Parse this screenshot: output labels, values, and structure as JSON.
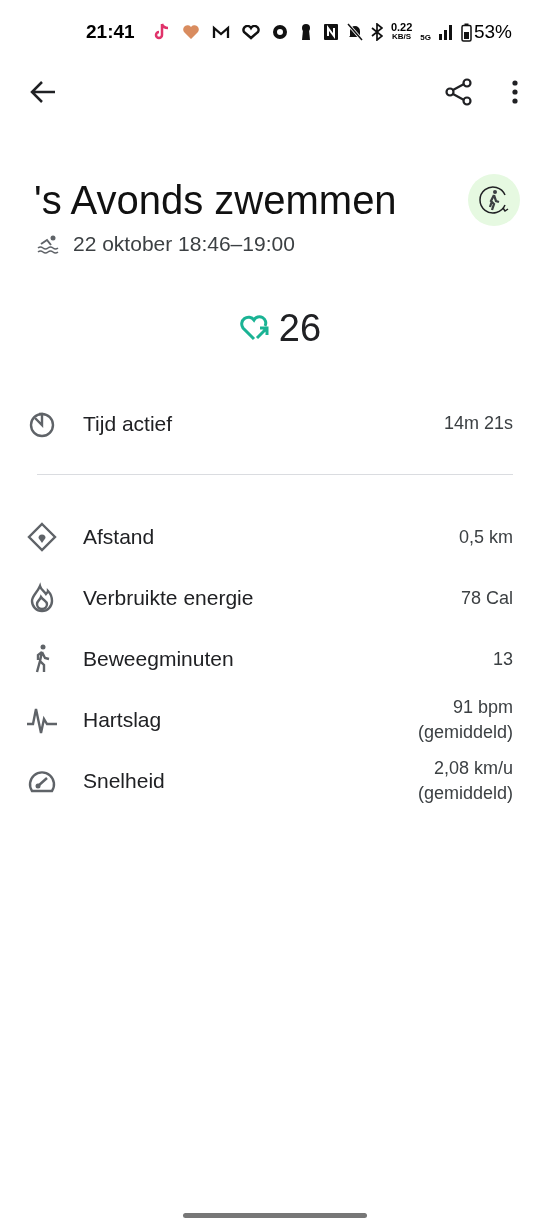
{
  "status_bar": {
    "time": "21:41",
    "net_speed": "0.22",
    "net_unit": "KB/S",
    "network": "5G",
    "battery": "53%"
  },
  "title": "'s Avonds zwemmen",
  "subtitle": "22 oktober 18:46–19:00",
  "heart_points": "26",
  "summary": [
    {
      "kind": "timer",
      "label": "Tijd actief",
      "value": "14m 21s"
    }
  ],
  "metrics": [
    {
      "kind": "distance",
      "label": "Afstand",
      "value": "0,5 km"
    },
    {
      "kind": "energy",
      "label": "Verbruikte energie",
      "value": "78 Cal"
    },
    {
      "kind": "move",
      "label": "Beweegminuten",
      "value": "13"
    },
    {
      "kind": "heart",
      "label": "Hartslag",
      "value": "91 bpm",
      "note": "(gemiddeld)"
    },
    {
      "kind": "speed",
      "label": "Snelheid",
      "value": "2,08 km/u",
      "note": "(gemiddeld)"
    }
  ]
}
